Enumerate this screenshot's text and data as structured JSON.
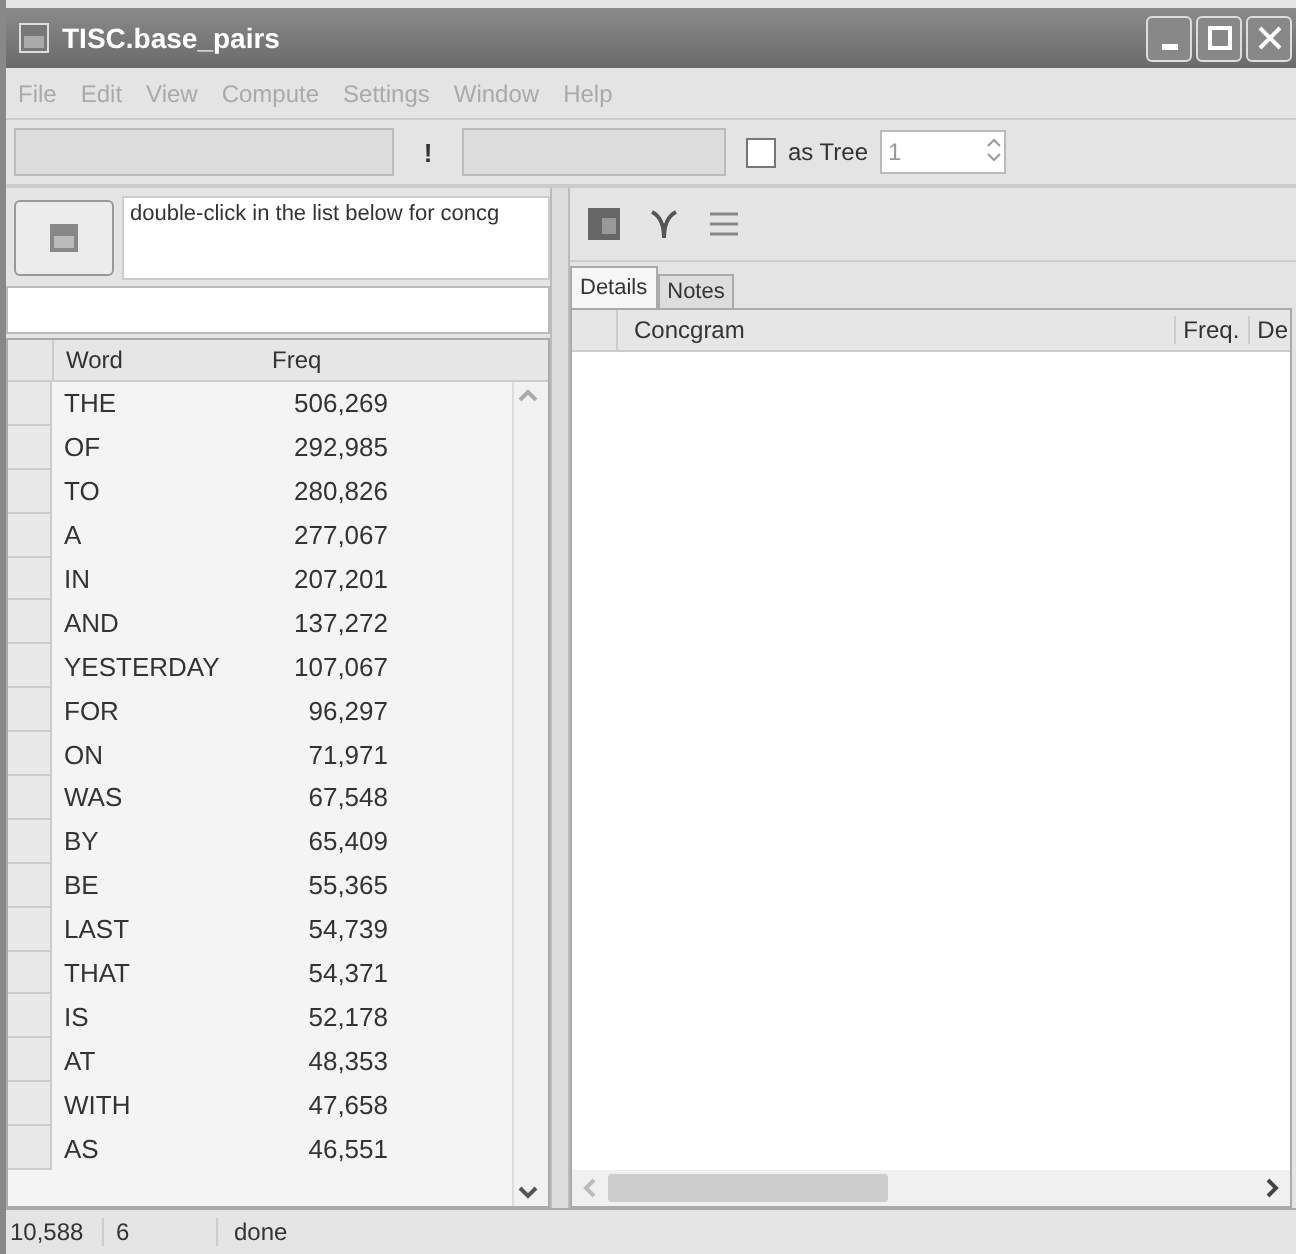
{
  "window": {
    "title": "TISC.base_pairs"
  },
  "menu": [
    {
      "label": "File",
      "disabled": true
    },
    {
      "label": "Edit",
      "disabled": true
    },
    {
      "label": "View",
      "disabled": true
    },
    {
      "label": "Compute",
      "disabled": true
    },
    {
      "label": "Settings",
      "disabled": true
    },
    {
      "label": "Window",
      "disabled": true
    },
    {
      "label": "Help",
      "disabled": true
    }
  ],
  "toolbar": {
    "bang": "!",
    "as_tree": {
      "label": "as Tree",
      "checked": false
    },
    "spin_value": "1"
  },
  "left": {
    "hint": "double-click in the list below for concg",
    "columns": [
      "Word",
      "Freq"
    ],
    "rows": [
      [
        "THE",
        "506,269"
      ],
      [
        "OF",
        "292,985"
      ],
      [
        "TO",
        "280,826"
      ],
      [
        "A",
        "277,067"
      ],
      [
        "IN",
        "207,201"
      ],
      [
        "AND",
        "137,272"
      ],
      [
        "YESTERDAY",
        "107,067"
      ],
      [
        "FOR",
        "96,297"
      ],
      [
        "ON",
        "71,971"
      ],
      [
        "WAS",
        "67,548"
      ],
      [
        "BY",
        "65,409"
      ],
      [
        "BE",
        "55,365"
      ],
      [
        "LAST",
        "54,739"
      ],
      [
        "THAT",
        "54,371"
      ],
      [
        "IS",
        "52,178"
      ],
      [
        "AT",
        "48,353"
      ],
      [
        "WITH",
        "47,658"
      ],
      [
        "AS",
        "46,551"
      ]
    ]
  },
  "right": {
    "tabs": [
      {
        "label": "Details",
        "selected": true
      },
      {
        "label": "Notes",
        "selected": false
      }
    ],
    "columns": [
      "Concgram",
      "Freq.",
      "De"
    ]
  },
  "status_bar": [
    "10,588",
    "6",
    "done"
  ]
}
